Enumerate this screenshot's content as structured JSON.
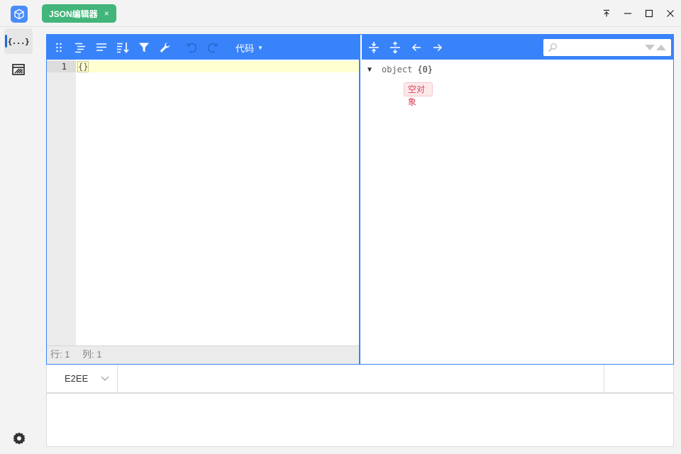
{
  "window": {
    "tab_label": "JSON编辑器",
    "tab_close": "×",
    "controls": [
      "pin-top-icon",
      "minimize-icon",
      "maximize-icon",
      "close-icon"
    ]
  },
  "sidebar": {
    "items": [
      {
        "icon": "json-icon",
        "label": "{...}",
        "active": true
      },
      {
        "icon": "encryption-icon",
        "active": false
      }
    ],
    "bottom_icon": "settings-icon"
  },
  "code_editor": {
    "toolbar_icons": [
      "drag-icon",
      "format-icon",
      "compact-icon",
      "sort-icon",
      "filter-icon",
      "repair-icon",
      "undo-icon",
      "redo-icon"
    ],
    "mode_label": "代码",
    "line_number": "1",
    "code": "{}",
    "status": {
      "row": "行: 1",
      "col": "列: 1"
    }
  },
  "tree_editor": {
    "toolbar_icons": [
      "expand-all-icon",
      "collapse-all-icon",
      "back-icon",
      "forward-icon"
    ],
    "search": {
      "placeholder": "",
      "value": ""
    },
    "root": {
      "key": "object",
      "count": "{0}"
    },
    "empty_label": "空对象"
  },
  "crypto_bar": {
    "algorithm": "E2EE",
    "key_placeholder": ""
  },
  "colors": {
    "accent_blue": "#3883fa",
    "tab_green": "#41b57a",
    "active_line": "#ffffd0",
    "empty_badge": "#d4485b"
  }
}
